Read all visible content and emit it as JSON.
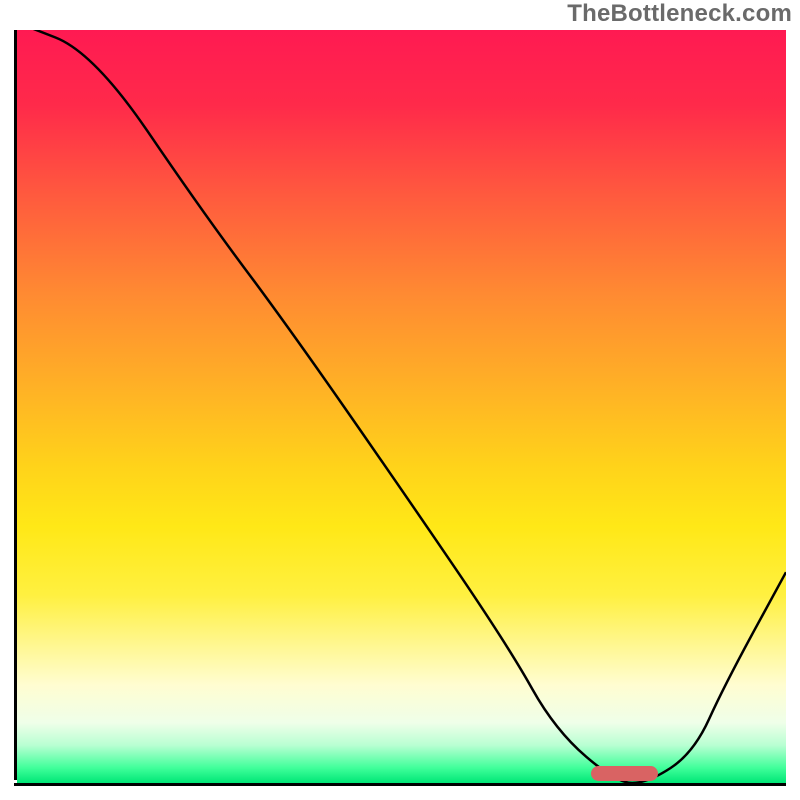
{
  "watermark": "TheBottleneck.com",
  "chart_data": {
    "type": "line",
    "title": "",
    "xlabel": "",
    "ylabel": "",
    "x_range": [
      0,
      100
    ],
    "y_range": [
      0,
      100
    ],
    "series": [
      {
        "name": "bottleneck-curve",
        "x": [
          0,
          10,
          24,
          35,
          50,
          64,
          70,
          78,
          82,
          88,
          92,
          100
        ],
        "y": [
          101,
          97,
          76,
          61,
          39,
          18,
          7,
          0,
          0,
          4,
          13,
          28
        ]
      }
    ],
    "grid": false,
    "legend": false,
    "marker": {
      "name": "sweet-spot-marker",
      "x_center_pct": 79,
      "y_pct": 1.3,
      "width_pct": 8.8,
      "height_pct": 2.0,
      "color": "#d96363"
    },
    "gradient_background": {
      "orientation": "vertical",
      "stops": [
        {
          "pct": 0,
          "color": "#ff1a52"
        },
        {
          "pct": 50,
          "color": "#ffc41a"
        },
        {
          "pct": 88,
          "color": "#fffde0"
        },
        {
          "pct": 100,
          "color": "#00e676"
        }
      ]
    }
  },
  "axes": {
    "left": true,
    "bottom": true
  }
}
